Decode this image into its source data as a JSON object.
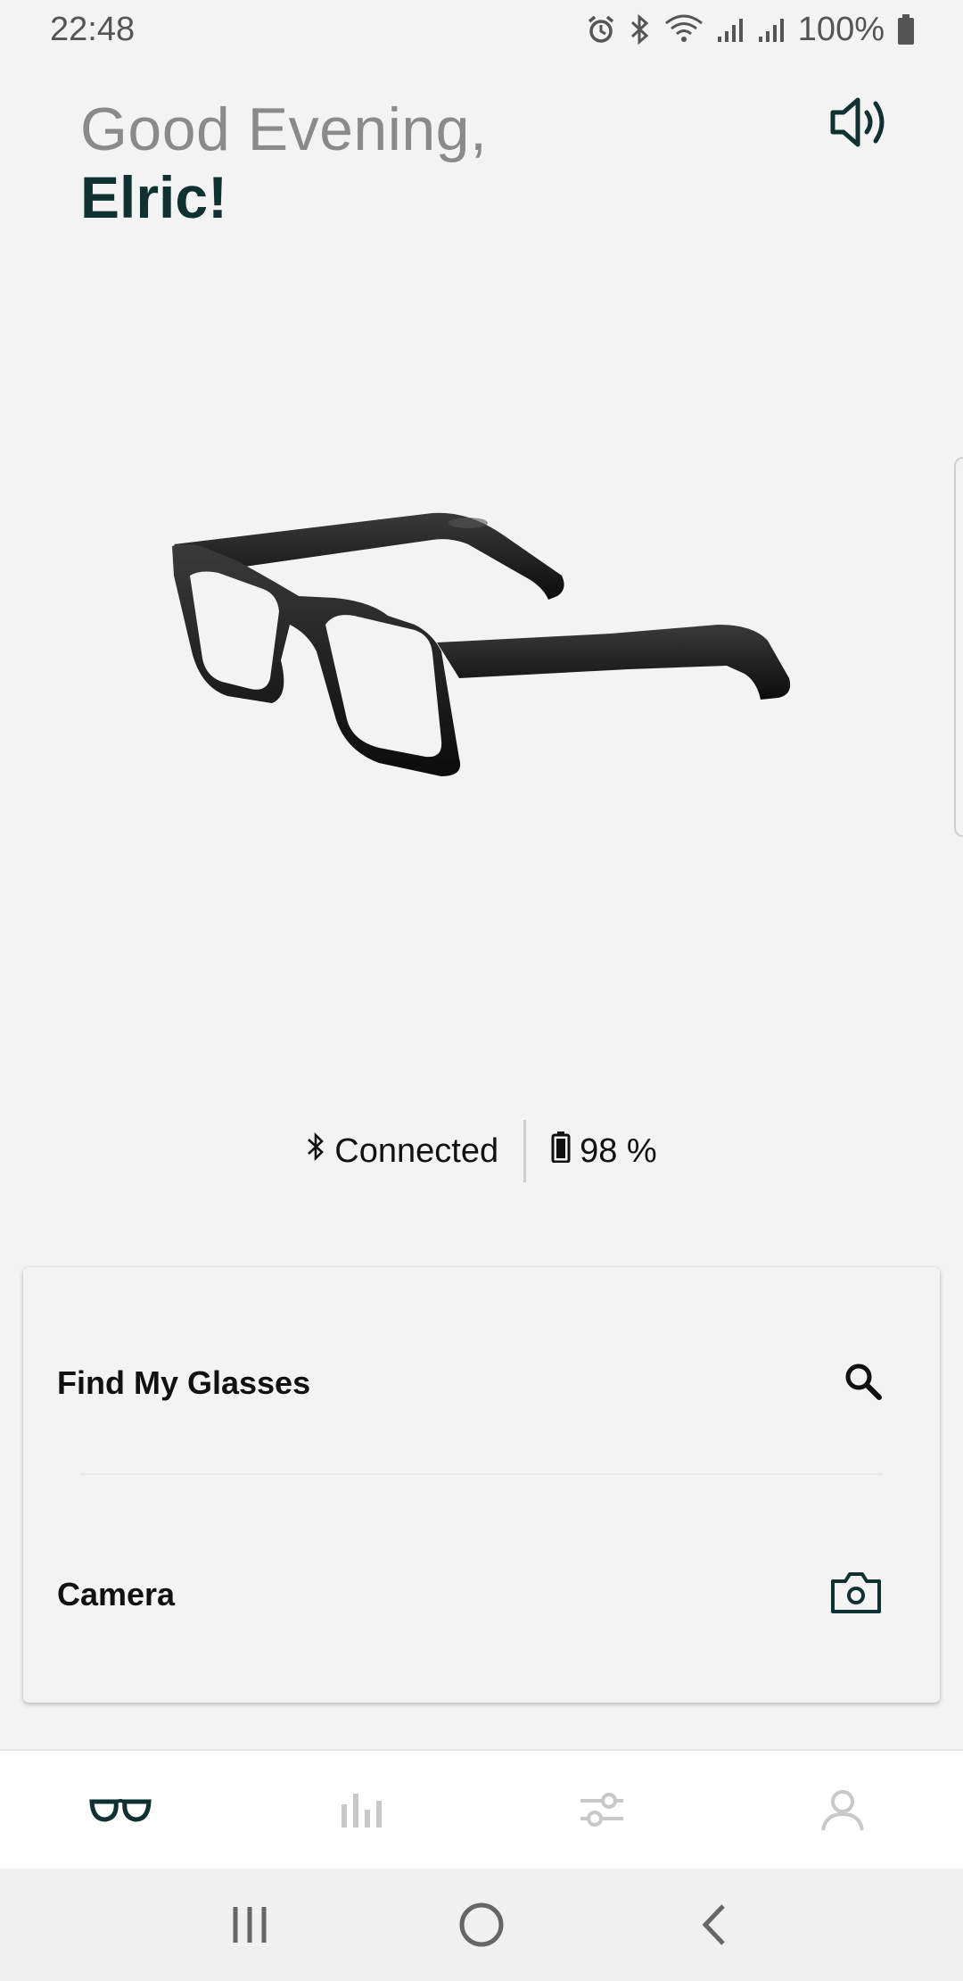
{
  "status_bar": {
    "time": "22:48",
    "battery_percent": "100%",
    "icons": [
      "alarm-icon",
      "bluetooth-icon",
      "wifi-icon",
      "signal-icon",
      "signal-icon",
      "battery-icon"
    ]
  },
  "greeting": {
    "line1": "Good Evening,",
    "line2": "Elric!"
  },
  "device": {
    "image": "smart-glasses",
    "connection_status": "Connected",
    "battery": "98 %"
  },
  "actions": [
    {
      "label": "Find My Glasses",
      "icon": "search-icon"
    },
    {
      "label": "Camera",
      "icon": "camera-icon"
    }
  ],
  "bottom_nav": {
    "tabs": [
      "glasses-icon",
      "stats-icon",
      "sliders-icon",
      "profile-icon"
    ],
    "active_index": 0
  },
  "colors": {
    "brand_dark": "#0f3230",
    "greeting_gray": "#8a8a8a",
    "inactive_icon": "#c8c8c8",
    "background": "#f3f3f3"
  }
}
